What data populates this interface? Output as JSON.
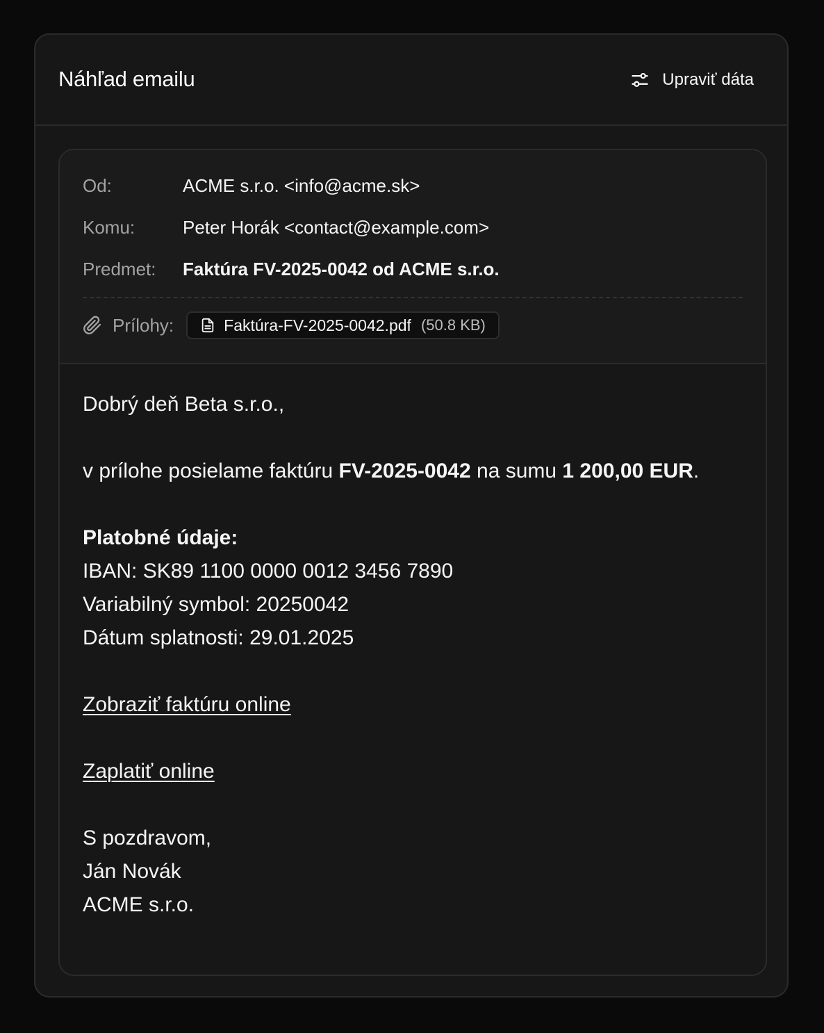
{
  "header": {
    "title": "Náhľad emailu",
    "edit_label": "Upraviť dáta",
    "edit_icon": "sliders-icon"
  },
  "meta": {
    "from_label": "Od:",
    "from_value": "ACME s.r.o. <info@acme.sk>",
    "to_label": "Komu:",
    "to_value": "Peter Horák <contact@example.com>",
    "subject_label": "Predmet:",
    "subject_value": "Faktúra FV-2025-0042 od ACME s.r.o.",
    "attachments_label": "Prílohy:",
    "attachments_icon": "paperclip-icon",
    "attachments": [
      {
        "name": "Faktúra-FV-2025-0042.pdf",
        "size": "(50.8 KB)",
        "icon": "file-icon"
      }
    ]
  },
  "body": {
    "greeting": "Dobrý deň Beta s.r.o.,",
    "intro_prefix": "v prílohe posielame faktúru ",
    "invoice_number": "FV-2025-0042",
    "intro_middle": " na sumu ",
    "amount": "1 200,00 EUR",
    "intro_suffix": ".",
    "payment_heading": "Platobné údaje:",
    "iban_line": "IBAN: SK89 1100 0000 0012 3456 7890",
    "vs_line": "Variabilný symbol: 20250042",
    "due_line": "Dátum splatnosti: 29.01.2025",
    "view_link": "Zobraziť faktúru online",
    "pay_link": "Zaplatiť online",
    "closing": "S pozdravom,",
    "sender_name": "Ján Novák",
    "sender_company": "ACME s.r.o."
  },
  "colors": {
    "page_bg": "#0a0a0a",
    "card_bg": "#171717",
    "border": "#2b2b2b",
    "text": "#f5f5f5",
    "muted": "#a3a3a3"
  }
}
